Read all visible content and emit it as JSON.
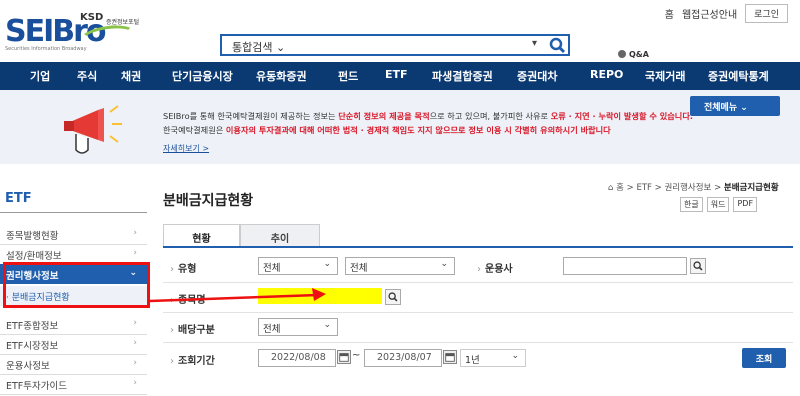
{
  "header": {
    "logo_text": "SEIBro",
    "logo_sub": "Securities Information Broadway",
    "ksd_text": "KSD",
    "ksd_sub": "증권정보포털",
    "top_links": [
      "홈",
      "웹접근성안내"
    ],
    "login_label": "로그인",
    "search_scope": "통합검색",
    "qna_label": "Q&A"
  },
  "nav": {
    "items": [
      "기업",
      "주식",
      "채권",
      "단기금융시장",
      "유동화증권",
      "펀드",
      "ETF",
      "파생결합증권",
      "증권대차",
      "REPO",
      "국제거래",
      "증권예탁통계"
    ]
  },
  "notice": {
    "line1_a": "SEIBro를 통해 한국예탁결제원이 제공하는 정보는 ",
    "line1_red1": "단순히 정보의 제공을 목적",
    "line1_b": "으로 하고 있으며, 불가피한 사유로 ",
    "line1_red2": "오류 · 지연 · 누락이 발생할 수 있습니다.",
    "line2_a": "한국예탁결제원은 ",
    "line2_red": "이용자의 투자결과에 대해 어떠한 법적 · 경제적 책임도 지지 않으므로 정보 이용 시 각별히 유의하시기 바랍니다",
    "more_label": "자세히보기 >",
    "allmenu_label": "전체메뉴"
  },
  "sidebar": {
    "title": "ETF",
    "items": [
      {
        "label": "종목발행현황"
      },
      {
        "label": "설정/환매정보"
      },
      {
        "label": "권리행사정보"
      },
      {
        "label": "· 분배금지급현황"
      },
      {
        "label": "ETF종합정보"
      },
      {
        "label": "ETF시장정보"
      },
      {
        "label": "운용사정보"
      },
      {
        "label": "ETF투자가이드"
      }
    ]
  },
  "main": {
    "page_title": "분배금지급현황",
    "breadcrumb": [
      "홈",
      "ETF",
      "권리행사정보",
      "분배금지급현황"
    ],
    "downloads": [
      "한글",
      "워드",
      "PDF"
    ],
    "tabs": [
      {
        "label": "현황"
      },
      {
        "label": "추이"
      }
    ],
    "form": {
      "type_label": "유형",
      "type_select1": "전체",
      "type_select2": "전체",
      "manager_label": "운용사",
      "name_label": "종목명",
      "dividend_label": "배당구분",
      "dividend_select": "전체",
      "period_label": "조회기간",
      "date_from": "2022/08/08",
      "date_to": "2023/08/07",
      "range_select": "1년",
      "query_label": "조회"
    }
  },
  "colors": {
    "brand_blue": "#1f5fae",
    "nav_blue": "#0b3a73",
    "warning_red": "#d8192a",
    "highlight_yellow": "#ffff00",
    "annotation_red": "#ee1111"
  }
}
